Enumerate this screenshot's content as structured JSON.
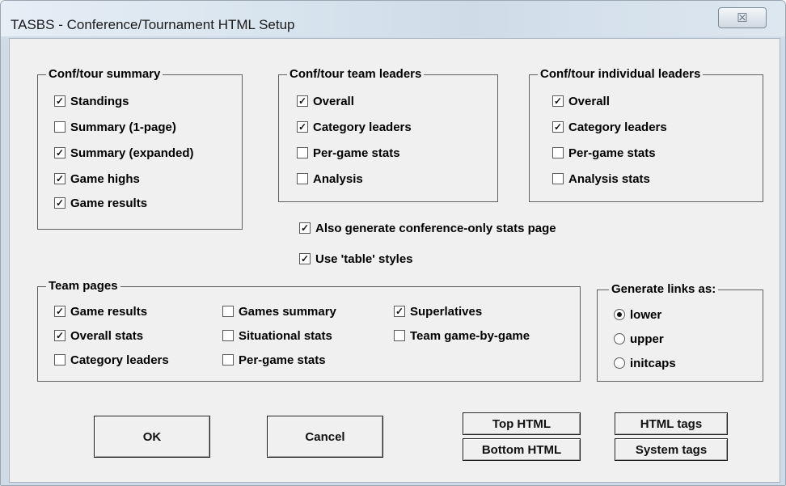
{
  "window": {
    "title": "TASBS - Conference/Tournament HTML Setup",
    "close_glyph": "☒"
  },
  "conf_summary": {
    "legend": "Conf/tour summary",
    "items": [
      {
        "label": "Standings",
        "checked": true
      },
      {
        "label": "Summary (1-page)",
        "checked": false
      },
      {
        "label": "Summary (expanded)",
        "checked": true
      },
      {
        "label": "Game highs",
        "checked": true
      },
      {
        "label": "Game results",
        "checked": true
      }
    ]
  },
  "team_leaders": {
    "legend": "Conf/tour team leaders",
    "items": [
      {
        "label": "Overall",
        "checked": true
      },
      {
        "label": "Category leaders",
        "checked": true
      },
      {
        "label": "Per-game stats",
        "checked": false
      },
      {
        "label": "Analysis",
        "checked": false
      }
    ]
  },
  "individual_leaders": {
    "legend": "Conf/tour individual leaders",
    "items": [
      {
        "label": "Overall",
        "checked": true
      },
      {
        "label": "Category leaders",
        "checked": true
      },
      {
        "label": "Per-game stats",
        "checked": false
      },
      {
        "label": "Analysis stats",
        "checked": false
      }
    ]
  },
  "options": {
    "conference_only": {
      "label": "Also generate conference-only stats page",
      "checked": true
    },
    "table_styles": {
      "label": "Use 'table' styles",
      "checked": true
    }
  },
  "team_pages": {
    "legend": "Team pages",
    "items": [
      {
        "label": "Game results",
        "checked": true
      },
      {
        "label": "Overall stats",
        "checked": true
      },
      {
        "label": "Category leaders",
        "checked": false
      },
      {
        "label": "Games summary",
        "checked": false
      },
      {
        "label": "Situational stats",
        "checked": false
      },
      {
        "label": "Per-game stats",
        "checked": false
      },
      {
        "label": "Superlatives",
        "checked": true
      },
      {
        "label": "Team game-by-game",
        "checked": false
      }
    ]
  },
  "links": {
    "legend": "Generate links as:",
    "options": [
      {
        "label": "lower",
        "selected": true
      },
      {
        "label": "upper",
        "selected": false
      },
      {
        "label": "initcaps",
        "selected": false
      }
    ]
  },
  "buttons": {
    "ok": "OK",
    "cancel": "Cancel",
    "top_html": "Top HTML",
    "bottom_html": "Bottom HTML",
    "html_tags": "HTML tags",
    "system_tags": "System tags"
  },
  "check_glyph": "✓"
}
